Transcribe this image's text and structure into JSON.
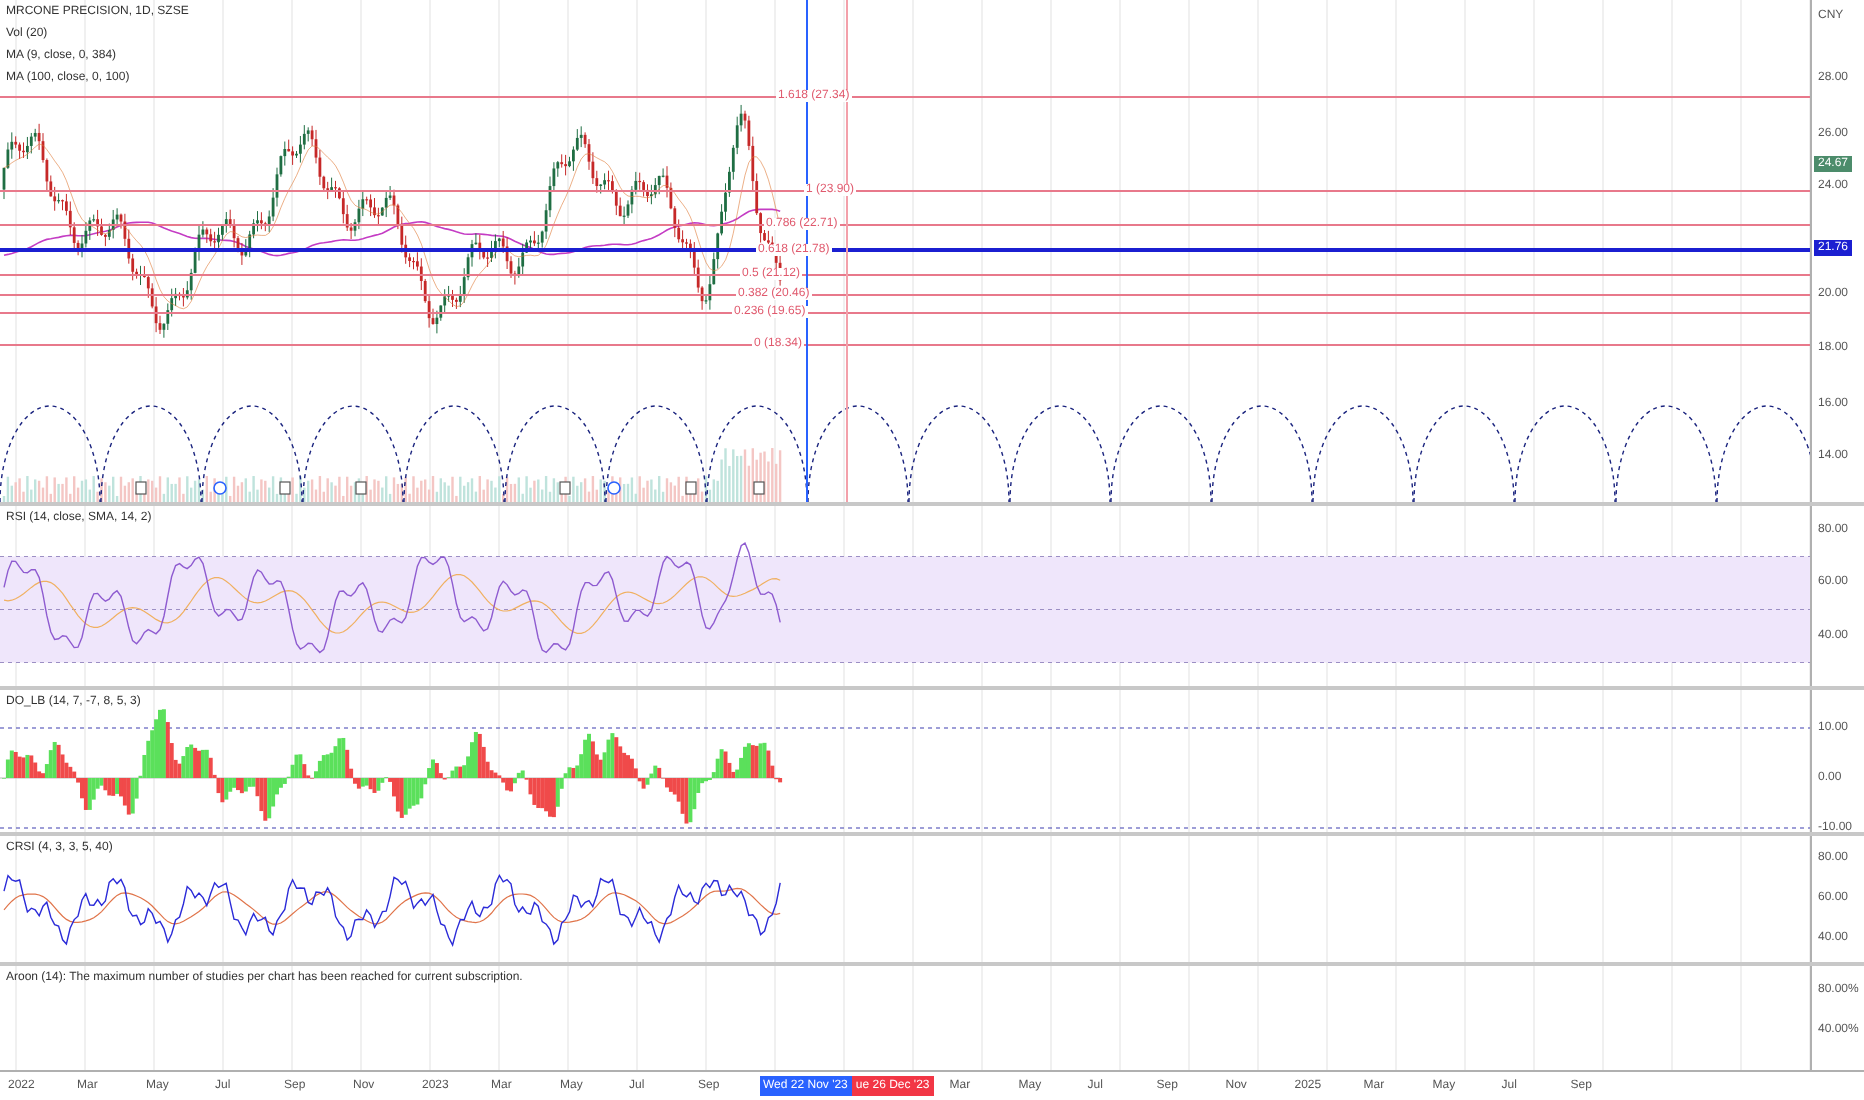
{
  "main_pane": {
    "legend": [
      "MRCONE PRECISION, 1D, SZSE",
      "Vol (20)",
      "MA (9, close, 0, 384)",
      "MA (100, close, 0, 100)"
    ],
    "axis_labels": [
      "CNY",
      "28.00",
      "26.00",
      "24.00",
      "20.00",
      "18.00",
      "16.00",
      "14.00"
    ],
    "price_badges": [
      {
        "text": "24.67",
        "color": "#4c8c6b"
      },
      {
        "text": "21.76",
        "color": "#1b1fd1"
      }
    ],
    "fib_levels": [
      {
        "label": "1.618 (27.34)"
      },
      {
        "label": "1 (23.90)"
      },
      {
        "label": "0.786 (22.71)"
      },
      {
        "label": "0.618 (21.78)"
      },
      {
        "label": "0.5 (21.12)"
      },
      {
        "label": "0.382 (20.46)"
      },
      {
        "label": "0.236 (19.65)"
      },
      {
        "label": "0 (18.34)"
      }
    ]
  },
  "indicator_panes": [
    {
      "kind": "rsi",
      "legend": "RSI (14, close, SMA, 14, 2)",
      "axis_labels": [
        "80.00",
        "60.00",
        "40.00"
      ]
    },
    {
      "kind": "dpo",
      "legend": "DO_LB (14, 7, -7, 8, 5, 3)",
      "axis_labels": [
        "10.00",
        "0.00",
        "-10.00"
      ]
    },
    {
      "kind": "crsi",
      "legend": "CRSI (4, 3, 3, 5, 40)",
      "axis_labels": [
        "80.00",
        "60.00",
        "40.00"
      ]
    },
    {
      "kind": "aroon",
      "legend": "Aroon (14): The maximum number of studies per chart has been reached for current subscription.",
      "axis_labels": [
        "80.00%",
        "40.00%"
      ]
    }
  ],
  "time_axis": {
    "labels_before": [
      "2022",
      "Mar",
      "May",
      "Jul",
      "Sep",
      "Nov",
      "2023",
      "Mar",
      "May",
      "Jul",
      "Sep"
    ],
    "cursor_badges": [
      {
        "text": "Wed 22 Nov '23",
        "color": "#2962ff"
      },
      {
        "text": "ue 26 Dec '23",
        "color": "#f23645"
      }
    ],
    "labels_after": [
      "Mar",
      "May",
      "Jul",
      "Sep",
      "Nov",
      "2025",
      "Mar",
      "May",
      "Jul",
      "Sep"
    ]
  }
}
